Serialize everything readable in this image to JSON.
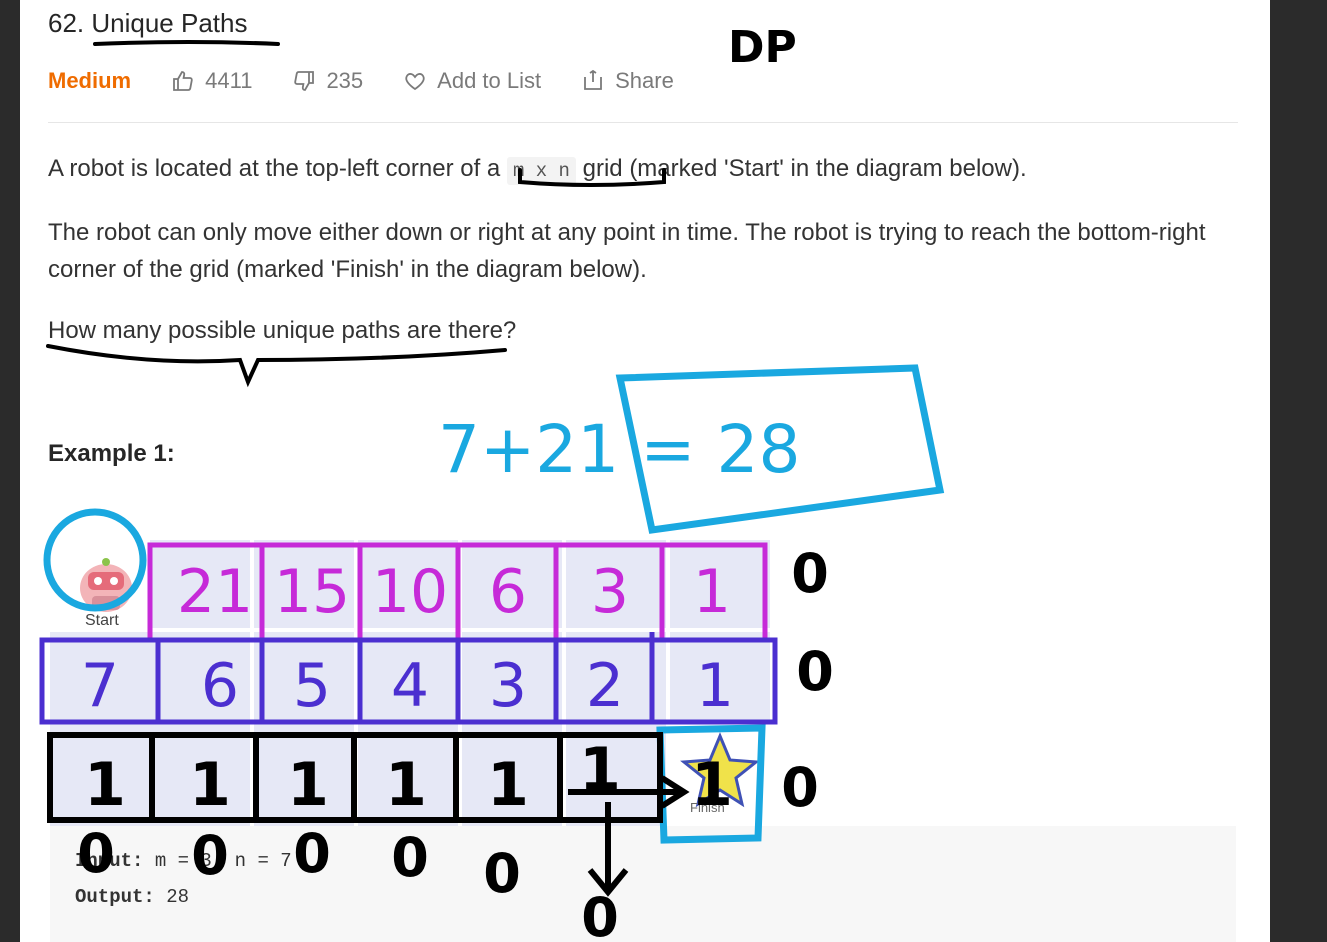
{
  "problem": {
    "title": "62. Unique Paths",
    "difficulty": "Medium",
    "likes": "4411",
    "dislikes": "235",
    "add_to_list": "Add to List",
    "share": "Share"
  },
  "description": {
    "line1_a": "A robot is located at the top-left corner of a",
    "line1_code": "m x n",
    "line1_b": "grid (marked 'Start' in the diagram below).",
    "para2": "The robot can only move either down or right at any point in time. The robot is trying to reach the bottom-right corner of the grid (marked 'Finish' in the diagram below).",
    "para3": "How many possible unique paths are there?"
  },
  "example": {
    "heading": "Example 1:",
    "start_label": "Start",
    "finish_label": "Finish",
    "input_label": "Input:",
    "input_value": "m = 3, n = 7",
    "output_label": "Output:",
    "output_value": "28"
  },
  "annotations": {
    "dp_note": "DP",
    "sum_note": "7+21 = 28",
    "row1": [
      "21",
      "15",
      "10",
      "6",
      "3",
      "1"
    ],
    "row2": [
      "7",
      "6",
      "5",
      "4",
      "3",
      "2",
      "1"
    ],
    "row3": [
      "1",
      "1",
      "1",
      "1",
      "1",
      "1",
      "1"
    ],
    "zeros": "0",
    "colors": {
      "black": "#000000",
      "blue_box": "#1aa8e0",
      "purple": "#c62ad8",
      "indigo": "#4b2fd0"
    }
  }
}
